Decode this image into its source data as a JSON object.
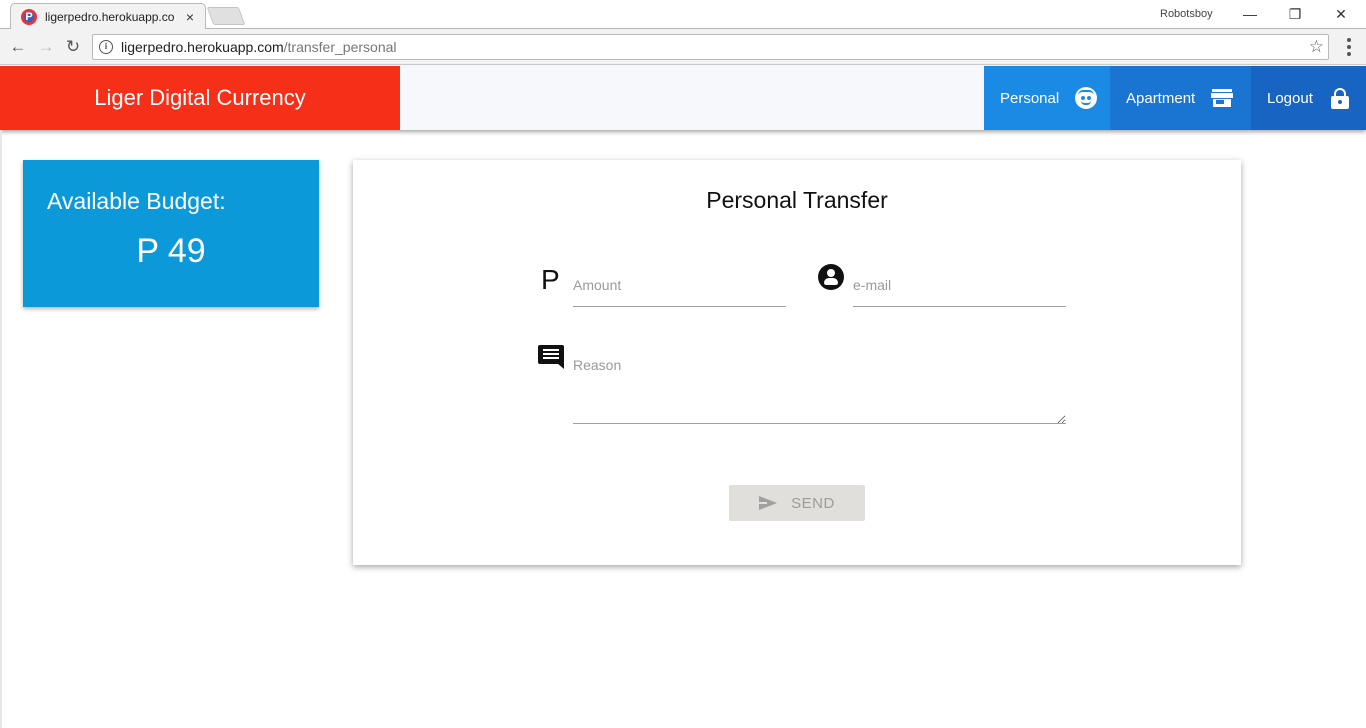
{
  "browser": {
    "tab_title": "ligerpedro.herokuapp.co",
    "tab_close": "×",
    "profile_name": "Robotsboy",
    "window_controls": {
      "minimize": "—",
      "restore": "❐",
      "close": "✕"
    },
    "url_host": "ligerpedro.herokuapp.com",
    "url_path": "/transfer_personal",
    "nav": {
      "back": "←",
      "forward": "→",
      "reload": "↻"
    },
    "star": "☆"
  },
  "header": {
    "brand": "Liger Digital Currency",
    "nav_items": [
      {
        "label": "Personal",
        "icon": "face-icon"
      },
      {
        "label": "Apartment",
        "icon": "store-icon"
      },
      {
        "label": "Logout",
        "icon": "lock-icon"
      }
    ]
  },
  "budget": {
    "title": "Available Budget:",
    "value": "P 49"
  },
  "transfer": {
    "title": "Personal Transfer",
    "amount_prefix": "P",
    "amount_placeholder": "Amount",
    "email_placeholder": "e-mail",
    "reason_placeholder": "Reason",
    "send_label": "SEND",
    "send_icon": "send-icon"
  },
  "colors": {
    "brand": "#f62f18",
    "nav_personal": "#1b8ae4",
    "nav_apartment": "#1a74d2",
    "nav_logout": "#1864c2",
    "budget_card": "#0c99da",
    "send_disabled": "#e0dfdc"
  }
}
